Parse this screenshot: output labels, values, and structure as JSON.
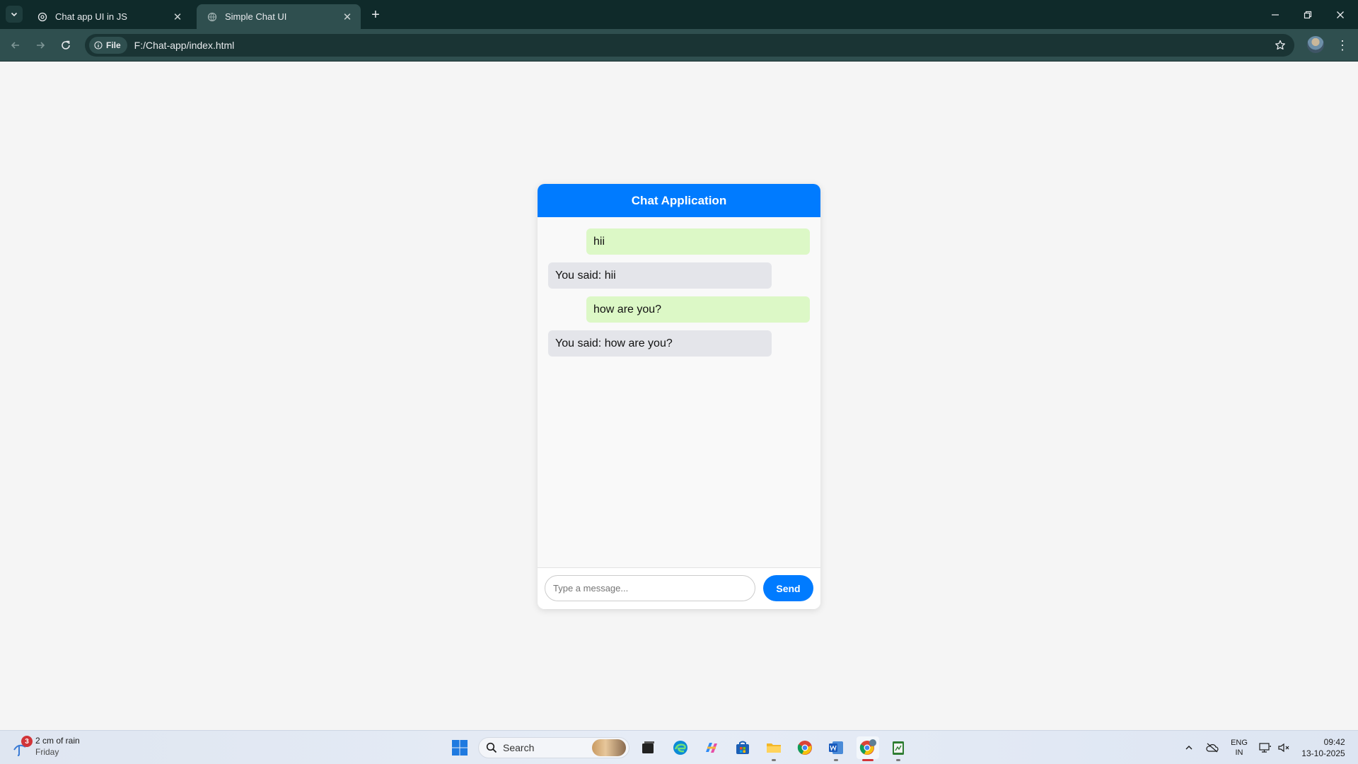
{
  "browser": {
    "tabs": [
      {
        "title": "Chat app UI in JS",
        "active": false
      },
      {
        "title": "Simple Chat UI",
        "active": true
      }
    ],
    "address": {
      "chip": "File",
      "url": "F:/Chat-app/index.html"
    }
  },
  "chat": {
    "header": "Chat Application",
    "messages": [
      {
        "from": "user",
        "text": "hii"
      },
      {
        "from": "bot",
        "text": "You said: hii"
      },
      {
        "from": "user",
        "text": "how are you?"
      },
      {
        "from": "bot",
        "text": "You said: how are you?"
      }
    ],
    "input": {
      "placeholder": "Type a message...",
      "value": ""
    },
    "send_label": "Send",
    "colors": {
      "accent": "#007bff",
      "user_bubble": "#dcf8c6",
      "bot_bubble": "#e4e5ea"
    }
  },
  "taskbar": {
    "weather": {
      "badge": "3",
      "line1": "2 cm of rain",
      "line2": "Friday"
    },
    "search_label": "Search",
    "lang": {
      "line1": "ENG",
      "line2": "IN"
    },
    "time": "09:42",
    "date": "13-10-2025"
  }
}
